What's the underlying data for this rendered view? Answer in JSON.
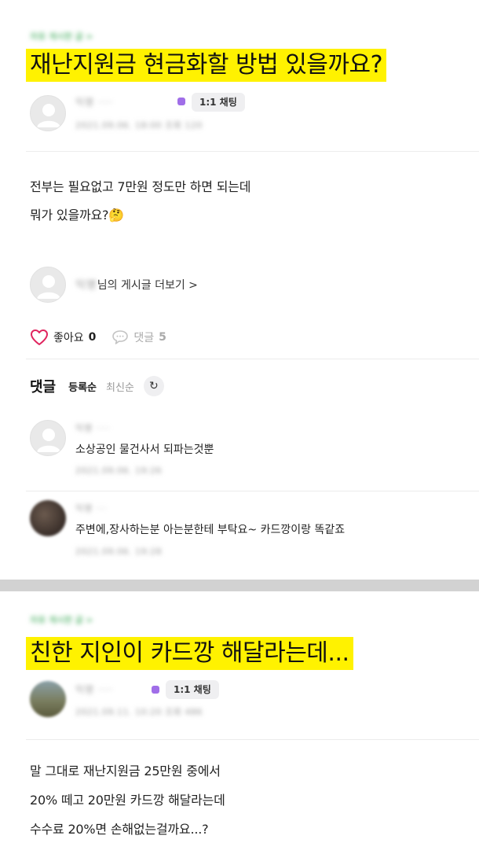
{
  "post1": {
    "breadcrumb": "자유 게시판 글 >",
    "title": "재난지원금 현금화할 방법 있을까요?",
    "author": {
      "name": "익명 ····",
      "meta": "2021.09.06. 18:00 조회 120"
    },
    "chat_label": "1:1 채팅",
    "body_lines": [
      "전부는 필요없고 7만원 정도만 하면 되는데",
      "뭐가 있을까요?🤔"
    ],
    "more": {
      "name": "익명",
      "suffix": "님의 게시글 더보기 >"
    },
    "like": {
      "label": "좋아요",
      "count": "0"
    },
    "comments_stat": {
      "label": "댓글",
      "count": "5"
    },
    "comments_section": {
      "title": "댓글",
      "sort_options": [
        "등록순",
        "최신순"
      ],
      "items": [
        {
          "author": "익명 ····",
          "text": "소상공인 물건사서 되파는것뿐",
          "date": "2021.09.06. 19:26"
        },
        {
          "author": "익명 ···",
          "text": "주변에,장사하는분 아는분한테 부탁요~ 카드깡이랑 똑같죠",
          "date": "2021.09.06. 19:28"
        }
      ]
    }
  },
  "post2": {
    "breadcrumb": "자유 게시판 글 >",
    "title": "친한 지인이 카드깡 해달라는데...",
    "author": {
      "name": "익명 ····",
      "meta": "2021.09.11. 10:20 조회 486"
    },
    "chat_label": "1:1 채팅",
    "body_lines": [
      "말 그대로 재난지원금 25만원 중에서",
      "20% 떼고 20만원 카드깡 해달라는데",
      "수수료 20%면 손해없는걸까요...?"
    ]
  },
  "icons": {
    "avatar": "default-avatar-icon",
    "heart": "heart-outline-icon",
    "comment": "speech-bubble-icon",
    "refresh": "refresh-icon"
  },
  "colors": {
    "highlight": "#fff200",
    "heart": "#e0245e",
    "badge": "#a06ee8"
  }
}
